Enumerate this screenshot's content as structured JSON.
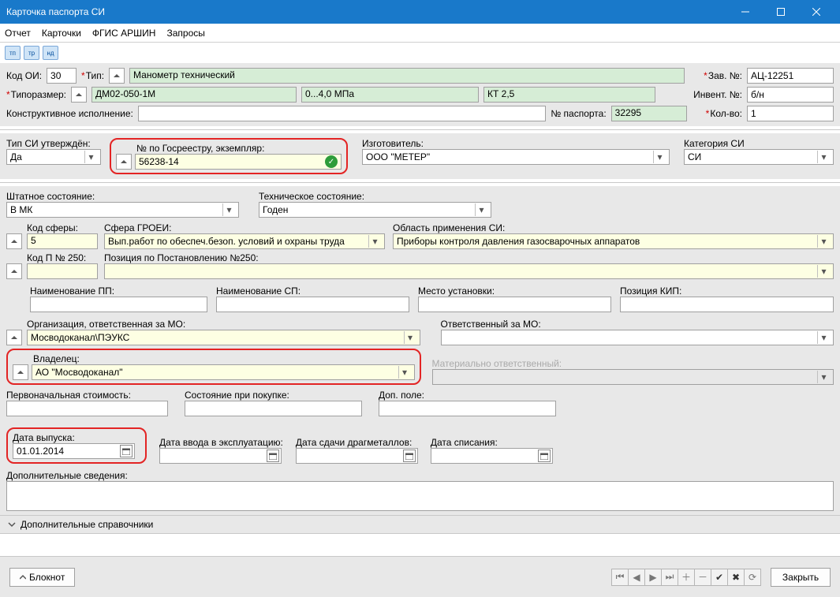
{
  "window": {
    "title": "Карточка паспорта СИ"
  },
  "menu": {
    "report": "Отчет",
    "cards": "Карточки",
    "fgis": "ФГИС АРШИН",
    "queries": "Запросы"
  },
  "toolicons": {
    "tp": "тп",
    "tr": "тр",
    "nd": "нд"
  },
  "header": {
    "code_oi_label": "Код ОИ:",
    "code_oi_value": "30",
    "type_label": "Тип:",
    "type_value": "Манометр технический",
    "typesize_label": "Типоразмер:",
    "typesize_value": "ДМ02-050-1М",
    "range_value": "0...4,0 МПа",
    "kt_value": "КТ 2,5",
    "constr_label": "Конструктивное исполнение:",
    "constr_value": "",
    "pass_no_label": "№ паспорта:",
    "pass_no_value": "32295",
    "zav_no_label": "Зав. №:",
    "zav_no_value": "АЦ-12251",
    "inv_no_label": "Инвент. №:",
    "inv_no_value": "б/н",
    "qty_label": "Кол-во:",
    "qty_value": "1"
  },
  "row2": {
    "type_si_label": "Тип СИ утверждён:",
    "type_si_value": "Да",
    "gosreestr_label": "№ по Госреестру, экземпляр:",
    "gosreestr_value": "56238-14",
    "manufacturer_label": "Изготовитель:",
    "manufacturer_value": "ООО \"МЕТЕР\"",
    "category_label": "Категория СИ",
    "category_value": "СИ"
  },
  "row3": {
    "staff_label": "Штатное состояние:",
    "staff_value": "В МК",
    "tech_label": "Техническое состояние:",
    "tech_value": "Годен"
  },
  "row4": {
    "sphere_code_label": "Код сферы:",
    "sphere_code_value": "5",
    "sphere_label": "Сфера ГРОЕИ:",
    "sphere_value": "Вып.работ по обеспеч.безоп. условий и охраны труда",
    "area_label": "Область применения СИ:",
    "area_value": "Приборы контроля давления газосварочных аппаратов"
  },
  "row5": {
    "code_p250_label": "Код П № 250:",
    "code_p250_value": "",
    "pos250_label": "Позиция по Постановлению №250:",
    "pos250_value": ""
  },
  "row6": {
    "pp_label": "Наименование ПП:",
    "sp_label": "Наименование СП:",
    "place_label": "Место установки:",
    "kip_label": "Позиция КИП:",
    "pp_value": "",
    "sp_value": "",
    "place_value": "",
    "kip_value": ""
  },
  "row7": {
    "org_label": "Организация, ответственная за МО:",
    "org_value": "Мосводоканал\\ПЭУКС",
    "resp_label": "Ответственный за МО:",
    "resp_value": ""
  },
  "row8": {
    "owner_label": "Владелец:",
    "owner_value": "АО \"Мосводоканал\"",
    "mat_label": "Материально ответственный:",
    "mat_value": ""
  },
  "row9": {
    "cost_label": "Первоначальная стоимость:",
    "cost_value": "",
    "purchase_label": "Состояние при покупке:",
    "purchase_value": "",
    "extra_label": "Доп. поле:",
    "extra_value": ""
  },
  "row10": {
    "release_label": "Дата выпуска:",
    "release_value": "01.01.2014",
    "commission_label": "Дата ввода в эксплуатацию:",
    "commission_value": "",
    "metal_label": "Дата сдачи драгметаллов:",
    "metal_value": "",
    "writeoff_label": "Дата списания:",
    "writeoff_value": ""
  },
  "row11": {
    "extra_info_label": "Дополнительные сведения:",
    "extra_info_value": ""
  },
  "expander": {
    "label": "Дополнительные справочники"
  },
  "bottom": {
    "notepad": "Блокнот",
    "close": "Закрыть"
  }
}
